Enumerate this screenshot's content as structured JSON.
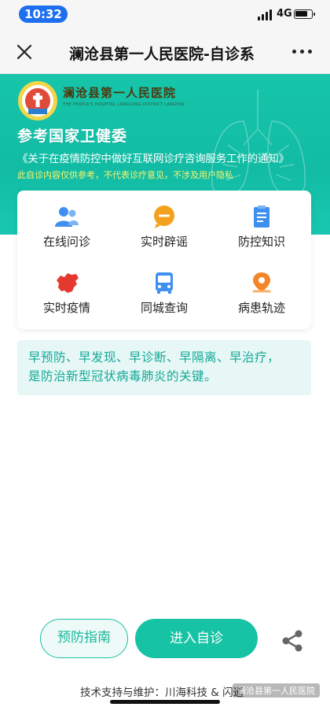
{
  "status_bar": {
    "time": "10:32",
    "network": "4G"
  },
  "nav": {
    "title": "澜沧县第一人民医院-自诊系"
  },
  "banner": {
    "hospital_name": "澜沧县第一人民医院",
    "hospital_name_en": "THE PEOPLE'S HOSPITAL LANGCANG DISTRICT LANGYAN",
    "headline": "参考国家卫健委",
    "notice": "《关于在疫情防控中做好互联网诊疗咨询服务工作的通知》",
    "disclaimer": "此自诊内容仅供参考，不代表诊疗意见，不涉及用户隐私"
  },
  "features": [
    {
      "label": "在线问诊",
      "icon": "users-icon",
      "color": "#3f8ff0"
    },
    {
      "label": "实时辟谣",
      "icon": "message-icon",
      "color": "#f4a11f"
    },
    {
      "label": "防控知识",
      "icon": "clipboard-icon",
      "color": "#3f8ff0"
    },
    {
      "label": "实时疫情",
      "icon": "china-map-icon",
      "color": "#e5392f"
    },
    {
      "label": "同城查询",
      "icon": "bus-icon",
      "color": "#3f8ff0"
    },
    {
      "label": "病患轨迹",
      "icon": "location-pin-icon",
      "color": "#f4862a"
    }
  ],
  "slogan": {
    "line1": "早预防、早发现、早诊断、早隔离、早治疗，",
    "line2": "是防治新型冠状病毒肺炎的关键。"
  },
  "actions": {
    "guide_label": "预防指南",
    "enter_label": "进入自诊"
  },
  "footer": {
    "credit": "技术支持与维护：川海科技 & 闪通",
    "watermark": "澜沧县第一人民医院"
  },
  "colors": {
    "accent": "#17c3a5",
    "banner": "#16c5aa",
    "slogan_text": "#12a896"
  }
}
